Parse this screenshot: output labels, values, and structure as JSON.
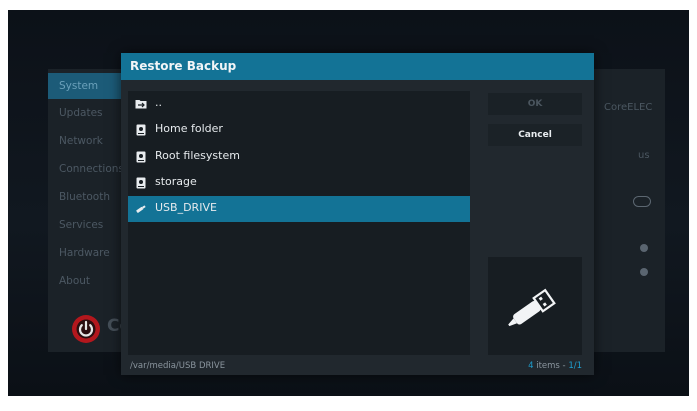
{
  "background": {
    "menu": [
      "System",
      "Updates",
      "Network",
      "Connections",
      "Bluetooth",
      "Services",
      "Hardware",
      "About"
    ],
    "selected_index": 0,
    "right_labels": {
      "brand": "CoreELEC",
      "locale": "us"
    },
    "logo_text": "Co"
  },
  "dialog": {
    "title": "Restore Backup",
    "items": [
      {
        "label": "..",
        "icon": "folder-up-icon",
        "selected": false
      },
      {
        "label": "Home folder",
        "icon": "drive-icon",
        "selected": false
      },
      {
        "label": "Root filesystem",
        "icon": "drive-icon",
        "selected": false
      },
      {
        "label": "storage",
        "icon": "drive-icon",
        "selected": false
      },
      {
        "label": "USB_DRIVE",
        "icon": "usb-icon",
        "selected": true
      }
    ],
    "buttons": {
      "ok": "OK",
      "cancel": "Cancel"
    },
    "thumbnail_icon": "usb-icon",
    "path": "/var/media/USB DRIVE",
    "count": {
      "number": "4",
      "label": " items - ",
      "page": "1/1"
    }
  },
  "colors": {
    "accent": "#137396",
    "highlight_text": "#1e9fd0"
  }
}
